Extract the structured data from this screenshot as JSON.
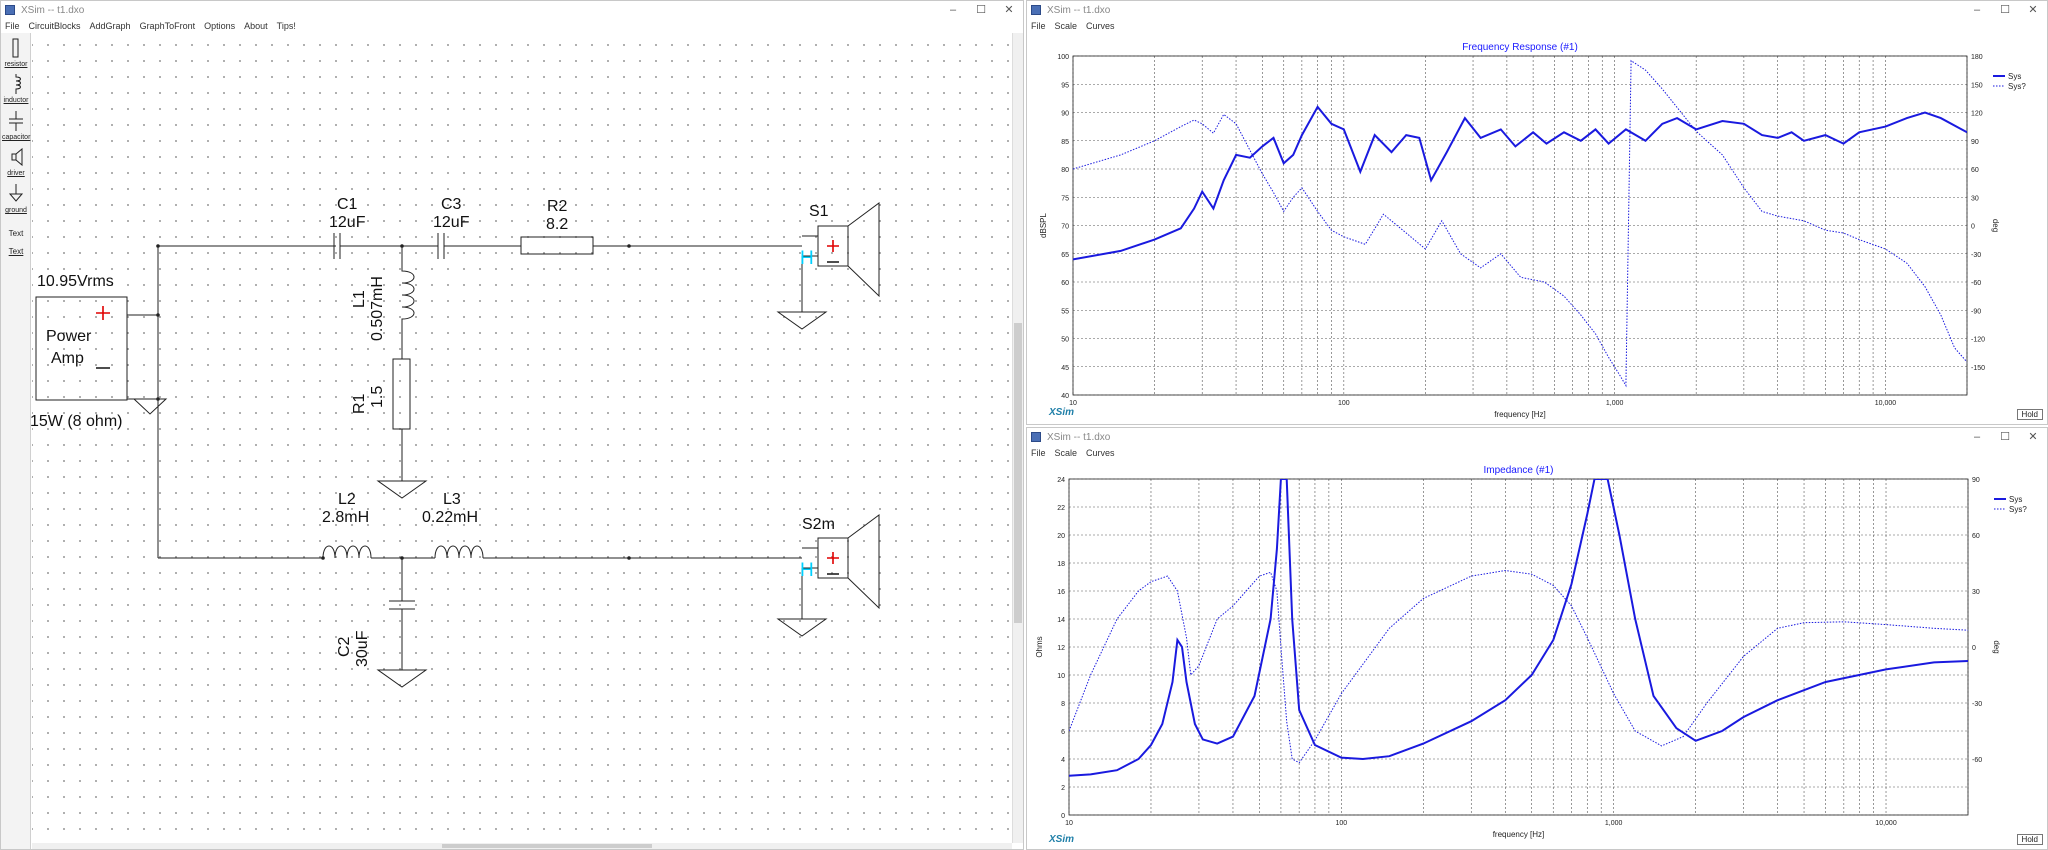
{
  "left_window": {
    "title": "XSim -- t1.dxo",
    "menu": [
      "File",
      "CircuitBlocks",
      "AddGraph",
      "GraphToFront",
      "Options",
      "About",
      "Tips!"
    ],
    "tools": [
      "resistor",
      "inductor",
      "capacitor",
      "driver",
      "ground",
      "Text",
      "Text"
    ],
    "components": {
      "c1_name": "C1",
      "c1_value": "12uF",
      "c3_name": "C3",
      "c3_value": "12uF",
      "r2_name": "R2",
      "r2_value": "8.2",
      "s1_name": "S1",
      "l1_name": "L1",
      "l1_value": "0.507mH",
      "r1_name": "R1",
      "r1_value": "1.5",
      "l2_name": "L2",
      "l2_value": "2.8mH",
      "l3_name": "L3",
      "l3_value": "0.22mH",
      "c2_name": "C2",
      "c2_value": "30uF",
      "s2_name": "S2m",
      "amp_voltage": "10.95Vrms",
      "amp_line1": "Power",
      "amp_line2": "Amp",
      "amp_power": "15W (8 ohm)"
    }
  },
  "graph1": {
    "window_title": "XSim -- t1.dxo",
    "menu": [
      "File",
      "Scale",
      "Curves"
    ],
    "logo": "XSim",
    "hold": "Hold",
    "legend": [
      "Sys",
      "Sys?"
    ]
  },
  "graph2": {
    "window_title": "XSim -- t1.dxo",
    "menu": [
      "File",
      "Scale",
      "Curves"
    ],
    "logo": "XSim",
    "hold": "Hold",
    "legend": [
      "Sys",
      "Sys?"
    ]
  },
  "chart_data": [
    {
      "type": "line",
      "title": "Frequency Response (#1)",
      "xlabel": "frequency [Hz]",
      "ylabel": "dBSPL",
      "y2label": "deg",
      "xscale": "log",
      "xlim": [
        10,
        20000
      ],
      "ylim": [
        40,
        100
      ],
      "y2lim": [
        -180,
        180
      ],
      "x_tick_labels": [
        "10",
        "100",
        "1,000",
        "10,000"
      ],
      "y_ticks": [
        40,
        45,
        50,
        55,
        60,
        65,
        70,
        75,
        80,
        85,
        90,
        95,
        100
      ],
      "y2_ticks": [
        -150,
        -120,
        -90,
        -60,
        -30,
        0,
        30,
        60,
        90,
        120,
        150,
        180
      ],
      "grid": true,
      "legend_position": "right",
      "series": [
        {
          "name": "Sys",
          "axis": "left",
          "style": "solid",
          "points": [
            [
              10,
              64
            ],
            [
              15,
              65.5
            ],
            [
              20,
              67.5
            ],
            [
              25,
              69.5
            ],
            [
              28,
              73
            ],
            [
              30,
              76
            ],
            [
              33,
              73
            ],
            [
              36,
              78
            ],
            [
              40,
              82.5
            ],
            [
              45,
              82
            ],
            [
              50,
              84
            ],
            [
              55,
              85.5
            ],
            [
              60,
              81
            ],
            [
              65,
              82.5
            ],
            [
              70,
              86
            ],
            [
              80,
              91
            ],
            [
              90,
              88
            ],
            [
              100,
              87
            ],
            [
              115,
              79.5
            ],
            [
              130,
              86
            ],
            [
              150,
              83
            ],
            [
              170,
              86
            ],
            [
              190,
              85.5
            ],
            [
              210,
              78
            ],
            [
              240,
              83
            ],
            [
              280,
              89
            ],
            [
              320,
              85.5
            ],
            [
              380,
              87
            ],
            [
              430,
              84
            ],
            [
              500,
              86.5
            ],
            [
              560,
              84.5
            ],
            [
              650,
              86.5
            ],
            [
              750,
              85
            ],
            [
              850,
              87
            ],
            [
              950,
              84.5
            ],
            [
              1100,
              87
            ],
            [
              1300,
              85
            ],
            [
              1500,
              88
            ],
            [
              1700,
              89
            ],
            [
              2000,
              87
            ],
            [
              2500,
              88.5
            ],
            [
              3000,
              88
            ],
            [
              3500,
              86
            ],
            [
              4000,
              85.5
            ],
            [
              4500,
              86.5
            ],
            [
              5000,
              85
            ],
            [
              6000,
              86
            ],
            [
              7000,
              84.5
            ],
            [
              8000,
              86.5
            ],
            [
              10000,
              87.5
            ],
            [
              12000,
              89
            ],
            [
              14000,
              90
            ],
            [
              16000,
              89
            ],
            [
              20000,
              86.5
            ]
          ]
        },
        {
          "name": "Sys?",
          "axis": "right",
          "style": "dotted",
          "points": [
            [
              10,
              60
            ],
            [
              15,
              75
            ],
            [
              20,
              90
            ],
            [
              25,
              105
            ],
            [
              28,
              112
            ],
            [
              30,
              108
            ],
            [
              33,
              98
            ],
            [
              36,
              118
            ],
            [
              40,
              108
            ],
            [
              45,
              80
            ],
            [
              50,
              55
            ],
            [
              55,
              35
            ],
            [
              60,
              15
            ],
            [
              65,
              30
            ],
            [
              70,
              40
            ],
            [
              80,
              15
            ],
            [
              90,
              -5
            ],
            [
              100,
              -12
            ],
            [
              120,
              -20
            ],
            [
              140,
              12
            ],
            [
              170,
              -8
            ],
            [
              200,
              -25
            ],
            [
              230,
              5
            ],
            [
              270,
              -30
            ],
            [
              320,
              -45
            ],
            [
              380,
              -30
            ],
            [
              450,
              -55
            ],
            [
              550,
              -60
            ],
            [
              650,
              -75
            ],
            [
              750,
              -95
            ],
            [
              850,
              -115
            ],
            [
              950,
              -140
            ],
            [
              1050,
              -160
            ],
            [
              1100,
              -170
            ],
            [
              1150,
              175
            ],
            [
              1300,
              165
            ],
            [
              1500,
              145
            ],
            [
              2000,
              100
            ],
            [
              2500,
              75
            ],
            [
              3000,
              40
            ],
            [
              3500,
              15
            ],
            [
              4000,
              10
            ],
            [
              5000,
              5
            ],
            [
              6000,
              -5
            ],
            [
              7000,
              -8
            ],
            [
              8000,
              -15
            ],
            [
              10000,
              -25
            ],
            [
              12000,
              -40
            ],
            [
              14000,
              -65
            ],
            [
              16000,
              -95
            ],
            [
              18000,
              -130
            ],
            [
              20000,
              -145
            ]
          ]
        }
      ]
    },
    {
      "type": "line",
      "title": "Impedance (#1)",
      "xlabel": "frequency [Hz]",
      "ylabel": "Ohms",
      "y2label": "deg",
      "xscale": "log",
      "xlim": [
        10,
        20000
      ],
      "ylim": [
        0,
        24
      ],
      "y2lim": [
        -90,
        90
      ],
      "x_tick_labels": [
        "10",
        "100",
        "1,000",
        "10,000"
      ],
      "y_ticks": [
        0,
        2,
        4,
        6,
        8,
        10,
        12,
        14,
        16,
        18,
        20,
        22,
        24
      ],
      "y2_ticks": [
        -60,
        -30,
        0,
        30,
        60,
        90
      ],
      "grid": true,
      "legend_position": "right",
      "series": [
        {
          "name": "Sys",
          "axis": "left",
          "style": "solid",
          "points": [
            [
              10,
              2.8
            ],
            [
              12,
              2.9
            ],
            [
              15,
              3.2
            ],
            [
              18,
              4.0
            ],
            [
              20,
              5.0
            ],
            [
              22,
              6.5
            ],
            [
              24,
              9.5
            ],
            [
              25,
              12.5
            ],
            [
              26,
              12.0
            ],
            [
              27,
              9.5
            ],
            [
              29,
              6.5
            ],
            [
              31,
              5.4
            ],
            [
              35,
              5.1
            ],
            [
              40,
              5.6
            ],
            [
              48,
              8.5
            ],
            [
              55,
              14.0
            ],
            [
              58,
              19.0
            ],
            [
              60,
              24.0
            ],
            [
              63,
              24.0
            ],
            [
              66,
              14.0
            ],
            [
              70,
              7.5
            ],
            [
              80,
              5.0
            ],
            [
              100,
              4.1
            ],
            [
              120,
              4.0
            ],
            [
              150,
              4.2
            ],
            [
              200,
              5.1
            ],
            [
              300,
              6.7
            ],
            [
              400,
              8.2
            ],
            [
              500,
              10.0
            ],
            [
              600,
              12.5
            ],
            [
              700,
              16.5
            ],
            [
              800,
              21.5
            ],
            [
              850,
              24.0
            ],
            [
              950,
              24.0
            ],
            [
              1050,
              20.0
            ],
            [
              1200,
              14.0
            ],
            [
              1400,
              8.5
            ],
            [
              1700,
              6.2
            ],
            [
              2000,
              5.3
            ],
            [
              2500,
              6.0
            ],
            [
              3000,
              7.0
            ],
            [
              4000,
              8.2
            ],
            [
              6000,
              9.5
            ],
            [
              10000,
              10.4
            ],
            [
              15000,
              10.9
            ],
            [
              20000,
              11.0
            ]
          ]
        },
        {
          "name": "Sys?",
          "axis": "right",
          "style": "dotted",
          "points": [
            [
              10,
              -45
            ],
            [
              12,
              -15
            ],
            [
              15,
              15
            ],
            [
              18,
              30
            ],
            [
              20,
              35
            ],
            [
              23,
              38
            ],
            [
              25,
              30
            ],
            [
              27,
              5
            ],
            [
              28,
              -15
            ],
            [
              30,
              -10
            ],
            [
              35,
              15
            ],
            [
              40,
              22
            ],
            [
              50,
              38
            ],
            [
              55,
              40
            ],
            [
              58,
              30
            ],
            [
              60,
              0
            ],
            [
              63,
              -40
            ],
            [
              66,
              -60
            ],
            [
              70,
              -62
            ],
            [
              80,
              -50
            ],
            [
              100,
              -25
            ],
            [
              150,
              10
            ],
            [
              200,
              26
            ],
            [
              300,
              38
            ],
            [
              400,
              41
            ],
            [
              500,
              39
            ],
            [
              600,
              33
            ],
            [
              700,
              22
            ],
            [
              800,
              5
            ],
            [
              1000,
              -25
            ],
            [
              1200,
              -45
            ],
            [
              1500,
              -53
            ],
            [
              1800,
              -48
            ],
            [
              2200,
              -30
            ],
            [
              3000,
              -5
            ],
            [
              4000,
              10
            ],
            [
              5000,
              13
            ],
            [
              7000,
              13.5
            ],
            [
              10000,
              12
            ],
            [
              15000,
              10
            ],
            [
              20000,
              9
            ]
          ]
        }
      ]
    }
  ]
}
